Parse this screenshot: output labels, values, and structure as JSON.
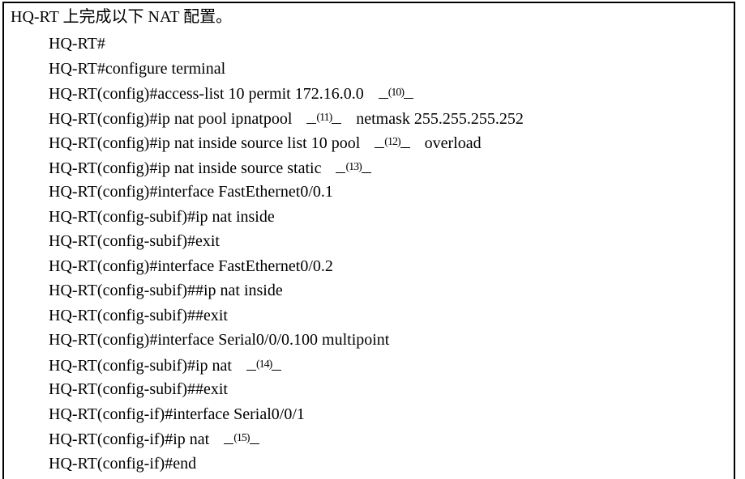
{
  "heading": "HQ-RT 上完成以下 NAT 配置。",
  "lines": [
    {
      "pre": "HQ-RT#",
      "blank": null,
      "post": ""
    },
    {
      "pre": "HQ-RT#configure terminal",
      "blank": null,
      "post": ""
    },
    {
      "pre": "HQ-RT(config)#access-list 10 permit 172.16.0.0",
      "blank": "(10)",
      "post": ""
    },
    {
      "pre": "HQ-RT(config)#ip nat pool ipnatpool",
      "blank": "(11)",
      "post": "netmask 255.255.255.252"
    },
    {
      "pre": "HQ-RT(config)#ip nat inside source list 10 pool",
      "blank": "(12)",
      "post": "overload"
    },
    {
      "pre": "HQ-RT(config)#ip nat inside source static",
      "blank": "(13)",
      "post": ""
    },
    {
      "pre": "HQ-RT(config)#interface FastEthernet0/0.1",
      "blank": null,
      "post": ""
    },
    {
      "pre": "HQ-RT(config-subif)#ip nat inside",
      "blank": null,
      "post": ""
    },
    {
      "pre": "HQ-RT(config-subif)#exit",
      "blank": null,
      "post": ""
    },
    {
      "pre": "HQ-RT(config)#interface FastEthernet0/0.2",
      "blank": null,
      "post": ""
    },
    {
      "pre": "HQ-RT(config-subif)##ip nat inside",
      "blank": null,
      "post": ""
    },
    {
      "pre": "HQ-RT(config-subif)##exit",
      "blank": null,
      "post": ""
    },
    {
      "pre": "HQ-RT(config)#interface Serial0/0/0.100 multipoint",
      "blank": null,
      "post": ""
    },
    {
      "pre": "HQ-RT(config-subif)#ip nat",
      "blank": "(14)",
      "post": ""
    },
    {
      "pre": "HQ-RT(config-subif)##exit",
      "blank": null,
      "post": ""
    },
    {
      "pre": "HQ-RT(config-if)#interface Serial0/0/1",
      "blank": null,
      "post": ""
    },
    {
      "pre": "HQ-RT(config-if)#ip nat",
      "blank": "(15)",
      "post": ""
    },
    {
      "pre": "HQ-RT(config-if)#end",
      "blank": null,
      "post": ""
    }
  ]
}
